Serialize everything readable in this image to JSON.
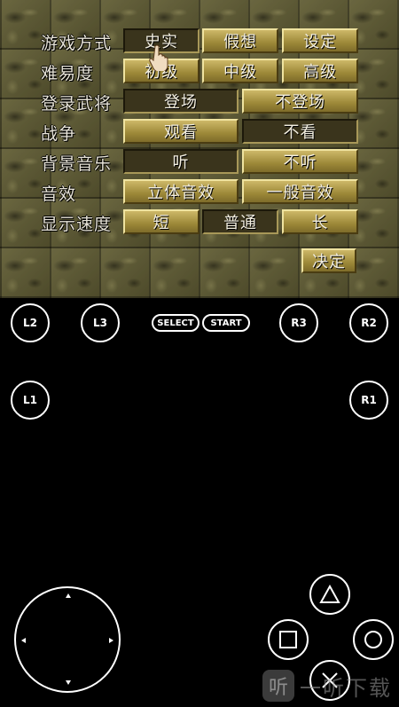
{
  "game": {
    "rows": [
      {
        "label": "游戏方式",
        "options": [
          "史实",
          "假想",
          "设定"
        ]
      },
      {
        "label": "难易度",
        "options": [
          "初级",
          "中级",
          "高级"
        ]
      },
      {
        "label": "登录武将",
        "options": [
          "登场",
          "不登场"
        ]
      },
      {
        "label": "战争",
        "options": [
          "观看",
          "不看"
        ]
      },
      {
        "label": "背景音乐",
        "options": [
          "听",
          "不听"
        ]
      },
      {
        "label": "音效",
        "options": [
          "立体音效",
          "一般音效"
        ]
      },
      {
        "label": "显示速度",
        "options": [
          "短",
          "普通",
          "长"
        ]
      }
    ],
    "confirm": "决定"
  },
  "controller": {
    "l2": "L2",
    "l3": "L3",
    "select": "SELECT",
    "start": "START",
    "r3": "R3",
    "r2": "R2",
    "l1": "L1",
    "r1": "R1",
    "icons": [
      "triangle-icon",
      "square-icon",
      "circle-icon",
      "cross-icon"
    ]
  },
  "watermark": {
    "logo": "听",
    "text": "一听下载"
  }
}
